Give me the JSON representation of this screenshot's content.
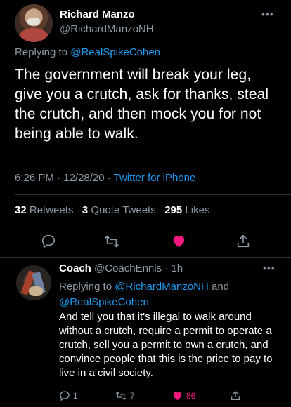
{
  "main_tweet": {
    "author_name": "Richard Manzo",
    "author_handle": "@RichardManzoNH",
    "replying_prefix": "Replying to ",
    "replying_handle": "@RealSpikeCohen",
    "text": "The government will break your leg, give you a crutch, ask for thanks, steal the crutch, and then mock you for not being able to walk.",
    "time": "6:26 PM · 12/28/20 · ",
    "source": "Twitter for iPhone",
    "stats": {
      "retweets_count": "32",
      "retweets_label": "Retweets",
      "quotes_count": "3",
      "quotes_label": "Quote Tweets",
      "likes_count": "295",
      "likes_label": "Likes"
    }
  },
  "reply_tweet": {
    "author_name": "Coach",
    "author_handle_time": "@CoachEnnis · 1h",
    "replying_prefix": "Replying to ",
    "replying_handle_1": "@RichardManzoNH",
    "replying_and": " and",
    "replying_handle_2": "@RealSpikeCohen",
    "text": "And tell you that it's illegal to walk around without a crutch, require a permit to operate a crutch, sell you a permit to own a crutch, and convince people that this is the price to pay to live in a civil society.",
    "replies_count": "1",
    "retweets_count": "7",
    "likes_count": "86"
  },
  "colors": {
    "background": "#000000",
    "muted": "#8b98a5",
    "link": "#1d9bf0",
    "like": "#f91880"
  },
  "icons": [
    "more-icon",
    "reply-icon",
    "retweet-icon",
    "like-heart-icon",
    "share-icon"
  ]
}
